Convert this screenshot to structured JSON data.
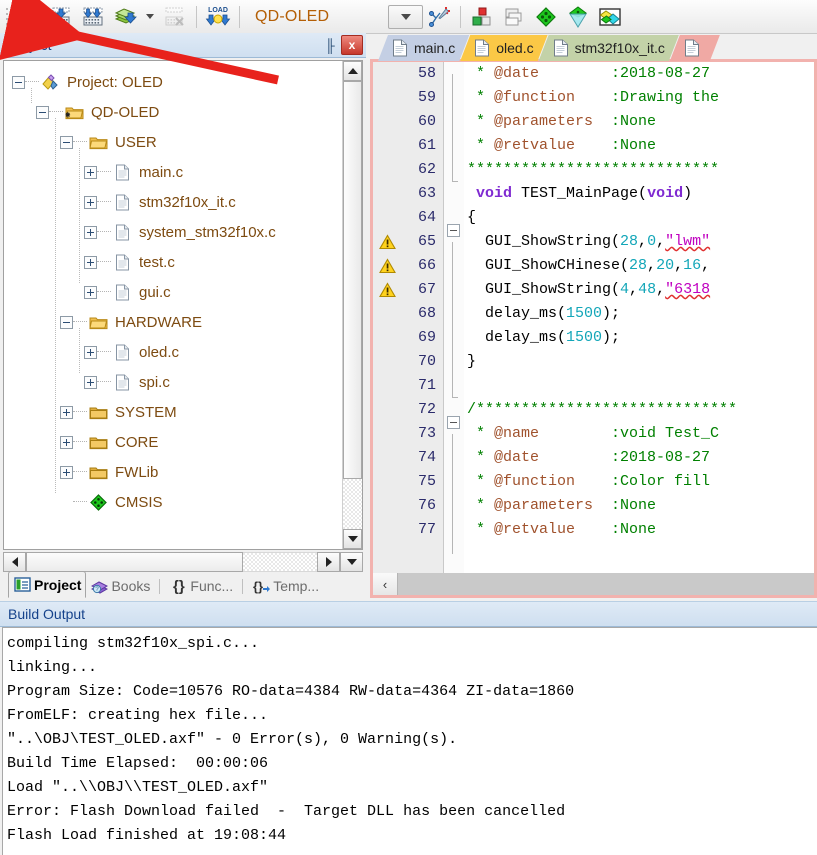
{
  "toolbar": {
    "buttons": [
      {
        "name": "translate-icon",
        "title": "Translate"
      },
      {
        "name": "build-icon",
        "title": "Build"
      },
      {
        "name": "rebuild-icon",
        "title": "Rebuild"
      },
      {
        "name": "batch-build-icon",
        "title": "Batch Build"
      },
      {
        "name": "stop-build-icon",
        "title": "Stop Build"
      },
      {
        "name": "download-icon",
        "title": "Download",
        "label": "LOAD"
      }
    ],
    "project_name": "QD-OLED",
    "right_buttons": [
      {
        "name": "target-combo-icon",
        "title": "Select Target"
      },
      {
        "name": "configure-wizard-icon",
        "title": "Configuration Wizard"
      },
      {
        "name": "manage-components-icon",
        "title": "Manage Project Items"
      },
      {
        "name": "multi-project-icon",
        "title": "Manage Multi-Project"
      },
      {
        "name": "pack-installer-icon",
        "title": "Pack Installer"
      },
      {
        "name": "run-time-env-icon",
        "title": "Manage Run-Time Environment"
      },
      {
        "name": "select-software-packs-icon",
        "title": "Select Software Packs"
      }
    ]
  },
  "project_panel": {
    "title": "Project",
    "pin_icon": "pin-icon",
    "close_label": "x",
    "tree": [
      {
        "label": "Project: OLED",
        "depth": 0,
        "expander": "minus",
        "icon": "project-icon"
      },
      {
        "label": "QD-OLED",
        "depth": 1,
        "expander": "minus",
        "icon": "target-folder-icon"
      },
      {
        "label": "USER",
        "depth": 2,
        "expander": "minus",
        "icon": "group-folder-open-icon"
      },
      {
        "label": "main.c",
        "depth": 3,
        "expander": "plus",
        "icon": "c-file-icon"
      },
      {
        "label": "stm32f10x_it.c",
        "depth": 3,
        "expander": "plus",
        "icon": "c-file-icon"
      },
      {
        "label": "system_stm32f10x.c",
        "depth": 3,
        "expander": "plus",
        "icon": "c-file-icon"
      },
      {
        "label": "test.c",
        "depth": 3,
        "expander": "plus",
        "icon": "c-file-icon"
      },
      {
        "label": "gui.c",
        "depth": 3,
        "expander": "plus",
        "icon": "c-file-icon"
      },
      {
        "label": "HARDWARE",
        "depth": 2,
        "expander": "minus",
        "icon": "group-folder-open-icon"
      },
      {
        "label": "oled.c",
        "depth": 3,
        "expander": "plus",
        "icon": "c-file-icon"
      },
      {
        "label": "spi.c",
        "depth": 3,
        "expander": "plus",
        "icon": "c-file-icon"
      },
      {
        "label": "SYSTEM",
        "depth": 2,
        "expander": "plus",
        "icon": "group-folder-icon"
      },
      {
        "label": "CORE",
        "depth": 2,
        "expander": "plus",
        "icon": "group-folder-icon"
      },
      {
        "label": "FWLib",
        "depth": 2,
        "expander": "plus",
        "icon": "group-folder-icon"
      },
      {
        "label": "CMSIS",
        "depth": 2,
        "expander": "none",
        "icon": "cmsis-icon"
      }
    ],
    "tabs": [
      {
        "label": "Project",
        "icon": "project-tab-icon",
        "active": true
      },
      {
        "label": "Books",
        "icon": "books-tab-icon",
        "active": false
      },
      {
        "label": "Func...",
        "icon": "functions-tab-icon",
        "active": false
      },
      {
        "label": "Temp...",
        "icon": "templates-tab-icon",
        "active": false
      }
    ]
  },
  "editor": {
    "tabs": [
      {
        "label": "main.c",
        "color": "#c4cfe4"
      },
      {
        "label": "oled.c",
        "color": "#fbc846"
      },
      {
        "label": "stm32f10x_it.c",
        "color": "#c3d2a8"
      },
      {
        "label": "",
        "color": "#f0a9a4"
      }
    ],
    "lines": [
      {
        "n": "58",
        "marker": "",
        "fold": "bar",
        "parts": [
          {
            "t": " * ",
            "c": "cmt"
          },
          {
            "t": "@date",
            "c": "cmt-at"
          },
          {
            "t": "        :2018-08-27",
            "c": "cmt"
          }
        ]
      },
      {
        "n": "59",
        "marker": "",
        "fold": "bar",
        "parts": [
          {
            "t": " * ",
            "c": "cmt"
          },
          {
            "t": "@function",
            "c": "cmt-at"
          },
          {
            "t": "    :Drawing the",
            "c": "cmt"
          }
        ]
      },
      {
        "n": "60",
        "marker": "",
        "fold": "bar",
        "parts": [
          {
            "t": " * ",
            "c": "cmt"
          },
          {
            "t": "@parameters",
            "c": "cmt-at"
          },
          {
            "t": "  :None",
            "c": "cmt"
          }
        ]
      },
      {
        "n": "61",
        "marker": "",
        "fold": "bar",
        "parts": [
          {
            "t": " * ",
            "c": "cmt"
          },
          {
            "t": "@retvalue",
            "c": "cmt-at"
          },
          {
            "t": "    :None",
            "c": "cmt"
          }
        ]
      },
      {
        "n": "62",
        "marker": "",
        "fold": "end",
        "parts": [
          {
            "t": "****************************",
            "c": "cmt"
          }
        ]
      },
      {
        "n": "63",
        "marker": "",
        "fold": "none",
        "parts": [
          {
            "t": " ",
            "c": "plain"
          },
          {
            "t": "void",
            "c": "kw"
          },
          {
            "t": " TEST_MainPage(",
            "c": "plain"
          },
          {
            "t": "void",
            "c": "kw"
          },
          {
            "t": ")",
            "c": "plain"
          }
        ]
      },
      {
        "n": "64",
        "marker": "",
        "fold": "box",
        "parts": [
          {
            "t": "{",
            "c": "plain"
          }
        ]
      },
      {
        "n": "65",
        "marker": "warning-icon",
        "fold": "bar",
        "parts": [
          {
            "t": "  GUI_ShowString(",
            "c": "plain"
          },
          {
            "t": "28",
            "c": "num"
          },
          {
            "t": ",",
            "c": "plain"
          },
          {
            "t": "0",
            "c": "num"
          },
          {
            "t": ",",
            "c": "plain"
          },
          {
            "t": "\"lwm\"",
            "c": "str sq"
          }
        ]
      },
      {
        "n": "66",
        "marker": "warning-icon",
        "fold": "bar",
        "parts": [
          {
            "t": "  GUI_ShowCHinese(",
            "c": "plain"
          },
          {
            "t": "28",
            "c": "num"
          },
          {
            "t": ",",
            "c": "plain"
          },
          {
            "t": "20",
            "c": "num"
          },
          {
            "t": ",",
            "c": "plain"
          },
          {
            "t": "16",
            "c": "num"
          },
          {
            "t": ",",
            "c": "plain"
          }
        ]
      },
      {
        "n": "67",
        "marker": "warning-icon",
        "fold": "bar",
        "parts": [
          {
            "t": "  GUI_ShowString(",
            "c": "plain"
          },
          {
            "t": "4",
            "c": "num"
          },
          {
            "t": ",",
            "c": "plain"
          },
          {
            "t": "48",
            "c": "num"
          },
          {
            "t": ",",
            "c": "plain"
          },
          {
            "t": "\"6318",
            "c": "str sq"
          }
        ]
      },
      {
        "n": "68",
        "marker": "",
        "fold": "bar",
        "parts": [
          {
            "t": "  delay_ms(",
            "c": "plain"
          },
          {
            "t": "1500",
            "c": "num"
          },
          {
            "t": ");",
            "c": "plain"
          }
        ]
      },
      {
        "n": "69",
        "marker": "",
        "fold": "bar",
        "parts": [
          {
            "t": "  delay_ms(",
            "c": "plain"
          },
          {
            "t": "1500",
            "c": "num"
          },
          {
            "t": ");",
            "c": "plain"
          }
        ]
      },
      {
        "n": "70",
        "marker": "",
        "fold": "bar",
        "parts": [
          {
            "t": "}",
            "c": "plain"
          }
        ]
      },
      {
        "n": "71",
        "marker": "",
        "fold": "end",
        "parts": [
          {
            "t": "",
            "c": "plain"
          }
        ]
      },
      {
        "n": "72",
        "marker": "",
        "fold": "box",
        "parts": [
          {
            "t": "/*****************************",
            "c": "cmt"
          }
        ]
      },
      {
        "n": "73",
        "marker": "",
        "fold": "bar",
        "parts": [
          {
            "t": " * ",
            "c": "cmt"
          },
          {
            "t": "@name",
            "c": "cmt-at"
          },
          {
            "t": "        :void Test_C",
            "c": "cmt"
          }
        ]
      },
      {
        "n": "74",
        "marker": "",
        "fold": "bar",
        "parts": [
          {
            "t": " * ",
            "c": "cmt"
          },
          {
            "t": "@date",
            "c": "cmt-at"
          },
          {
            "t": "        :2018-08-27",
            "c": "cmt"
          }
        ]
      },
      {
        "n": "75",
        "marker": "",
        "fold": "bar",
        "parts": [
          {
            "t": " * ",
            "c": "cmt"
          },
          {
            "t": "@function",
            "c": "cmt-at"
          },
          {
            "t": "    :Color fill",
            "c": "cmt"
          }
        ]
      },
      {
        "n": "76",
        "marker": "",
        "fold": "bar",
        "parts": [
          {
            "t": " * ",
            "c": "cmt"
          },
          {
            "t": "@parameters",
            "c": "cmt-at"
          },
          {
            "t": "  :None",
            "c": "cmt"
          }
        ]
      },
      {
        "n": "77",
        "marker": "",
        "fold": "bar",
        "parts": [
          {
            "t": " * ",
            "c": "cmt"
          },
          {
            "t": "@retvalue",
            "c": "cmt-at"
          },
          {
            "t": "    :None",
            "c": "cmt"
          }
        ]
      }
    ],
    "hscroll_left_label": "‹"
  },
  "build_output": {
    "title": "Build Output",
    "text": "compiling stm32f10x_spi.c...\nlinking...\nProgram Size: Code=10576 RO-data=4384 RW-data=4364 ZI-data=1860\nFromELF: creating hex file...\n\"..\\OBJ\\TEST_OLED.axf\" - 0 Error(s), 0 Warning(s).\nBuild Time Elapsed:  00:00:06\nLoad \"..\\\\OBJ\\\\TEST_OLED.axf\"\nError: Flash Download failed  -  Target DLL has been cancelled\nFlash Load finished at 19:08:44"
  },
  "annotation": {
    "arrow_color": "#e8221c",
    "name": "red-arrow-annotation"
  },
  "colors": {
    "accent_orange": "#b45f06",
    "panel_title_blue": "#15428b",
    "comment_green": "#008000",
    "keyword_purple": "#7f2ad1",
    "number_cyan": "#13a6b8",
    "string_magenta": "#c000c0",
    "editor_border_pink": "#f2b2ae"
  }
}
